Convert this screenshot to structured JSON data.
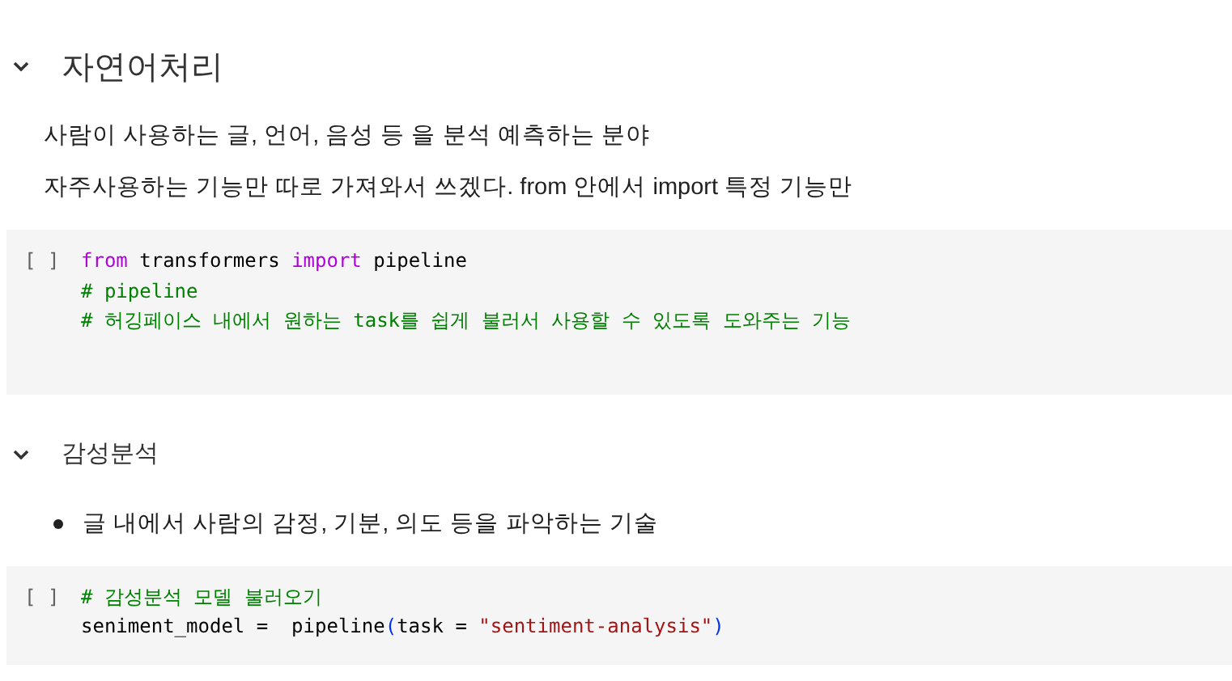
{
  "cells": [
    {
      "kind": "heading",
      "expanded": true,
      "text": "자연어처리"
    },
    {
      "kind": "text",
      "text": "사람이 사용하는 글, 언어, 음성 등 을 분석 예측하는 분야"
    },
    {
      "kind": "text",
      "text": "자주사용하는 기능만 따로 가져와서 쓰겠다. from 안에서 import 특정 기능만"
    },
    {
      "kind": "code",
      "bracket": "[ ]",
      "lines": [
        [
          {
            "kind": "keyword",
            "text": "from"
          },
          {
            "kind": "plain",
            "text": " transformers "
          },
          {
            "kind": "keyword",
            "text": "import"
          },
          {
            "kind": "plain",
            "text": " pipeline"
          }
        ],
        [
          {
            "kind": "comment",
            "text": "# pipeline"
          }
        ],
        [
          {
            "kind": "comment",
            "text": "# 허깅페이스 내에서 원하는 task를 쉽게 불러서 사용할 수 있도록 도와주는 기능"
          }
        ]
      ]
    },
    {
      "kind": "subheading",
      "expanded": true,
      "text": "감성분석"
    },
    {
      "kind": "bullet",
      "text": "글 내에서 사람의 감정, 기분, 의도 등을 파악하는 기술"
    },
    {
      "kind": "code",
      "bracket": "[ ]",
      "lines": [
        [
          {
            "kind": "comment",
            "text": "# 감성분석 모델 불러오기"
          }
        ],
        [
          {
            "kind": "plain",
            "text": "seniment_model =  pipeline"
          },
          {
            "kind": "paren",
            "text": "("
          },
          {
            "kind": "plain",
            "text": "task = "
          },
          {
            "kind": "string",
            "text": "\"sentiment-analysis\""
          },
          {
            "kind": "paren",
            "text": ")"
          }
        ]
      ]
    }
  ]
}
